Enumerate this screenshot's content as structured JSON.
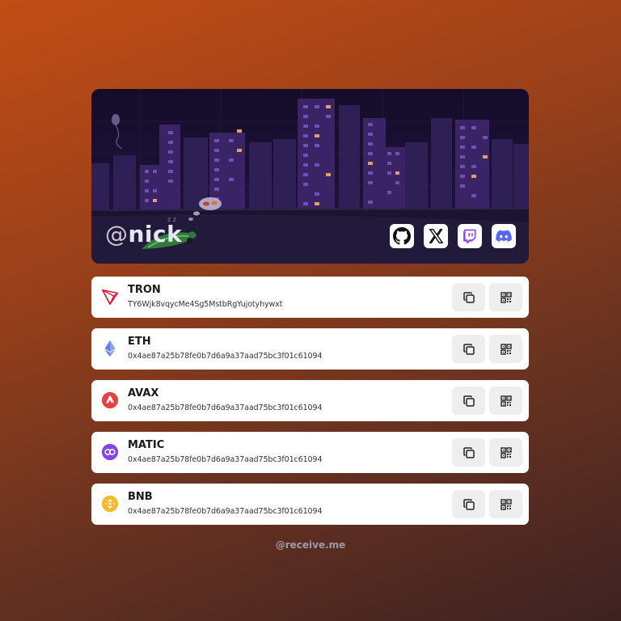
{
  "profile": {
    "at_sign": "@",
    "username": "nick"
  },
  "socials": [
    {
      "icon": "github-icon"
    },
    {
      "icon": "x-icon"
    },
    {
      "icon": "twitch-icon"
    },
    {
      "icon": "discord-icon"
    }
  ],
  "wallets": [
    {
      "name": "TRON",
      "address": "TY6Wjk8vqycMe4Sg5MstbRgYujotyhywxt",
      "icon": "tron-icon",
      "color": "#eb0029"
    },
    {
      "name": "ETH",
      "address": "0x4ae87a25b78fe0b7d6a9a37aad75bc3f01c61094",
      "icon": "ethereum-icon",
      "color": "#627eea"
    },
    {
      "name": "AVAX",
      "address": "0x4ae87a25b78fe0b7d6a9a37aad75bc3f01c61094",
      "icon": "avalanche-icon",
      "color": "#e84142"
    },
    {
      "name": "MATIC",
      "address": "0x4ae87a25b78fe0b7d6a9a37aad75bc3f01c61094",
      "icon": "polygon-icon",
      "color": "#8247e5"
    },
    {
      "name": "BNB",
      "address": "0x4ae87a25b78fe0b7d6a9a37aad75bc3f01c61094",
      "icon": "bnb-icon",
      "color": "#f3ba2f"
    }
  ],
  "actions": {
    "copy_icon": "copy-icon",
    "qr_icon": "qr-code-icon"
  },
  "footer": {
    "text": "@receive.me"
  }
}
